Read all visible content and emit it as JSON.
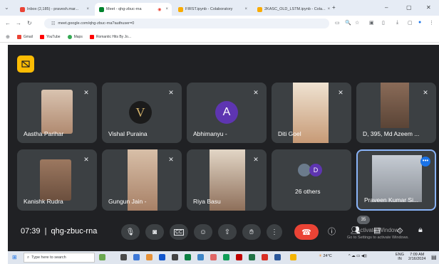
{
  "browser": {
    "tabs": [
      {
        "label": "Inbox (2,185) - pravesh.mar...",
        "close": "×"
      },
      {
        "label": "Meet - qhg-zbuc-rna",
        "close": "×"
      },
      {
        "label": "FIRST.ipynb - Colaboratory",
        "close": "×"
      },
      {
        "label": "2KASC_OLD_LSTM.ipynb - Cola...",
        "close": "×"
      }
    ],
    "new_tab": "+",
    "window_controls": {
      "minimize": "–",
      "maximize": "▢",
      "close": "✕"
    },
    "url": "meet.google.com/qhg-zbuc-rna?authuser=0",
    "bookmarks": [
      "Gmail",
      "YouTube",
      "Maps",
      "Romantic Hits By Jo..."
    ]
  },
  "meet": {
    "participants": [
      {
        "name": "Aastha Parihar"
      },
      {
        "name": "Vishal Puraina"
      },
      {
        "name": "Abhimanyu -",
        "avatar_letter": "A"
      },
      {
        "name": "Diti Goel"
      },
      {
        "name": "D, 395, Md Azeem ..."
      },
      {
        "name": "Kanishk Rudra"
      },
      {
        "name": "Gungun Jain -"
      },
      {
        "name": "Riya Basu"
      },
      {
        "name": "26 others",
        "avatar_letter": "D"
      },
      {
        "name": "Praveen Kumar Si..."
      }
    ],
    "time": "07:39",
    "separator": "|",
    "meeting_code": "qhg-zbuc-rna",
    "participant_count": "35",
    "more_options": "⋮",
    "watermark_title": "Activate Windows",
    "watermark_sub": "Go to Settings to activate Windows."
  },
  "taskbar": {
    "search_placeholder": "Type here to search",
    "weather": "24°C",
    "lang": "ENG",
    "lang_sub": "IN",
    "time": "7:09 AM",
    "date": "2/16/2024"
  },
  "icons": {
    "mic": "mic-off-icon",
    "camera": "camera-icon",
    "captions": "captions-icon",
    "emoji": "emoji-icon",
    "present": "present-icon",
    "hand": "raise-hand-icon",
    "end": "end-call-icon"
  },
  "colors": {
    "meet_bg": "#202124",
    "tile_bg": "#3c4043",
    "end_call": "#ea4335",
    "accent": "#1a73e8",
    "logo": "#fbbc04",
    "avatar": "#5e35b1"
  }
}
